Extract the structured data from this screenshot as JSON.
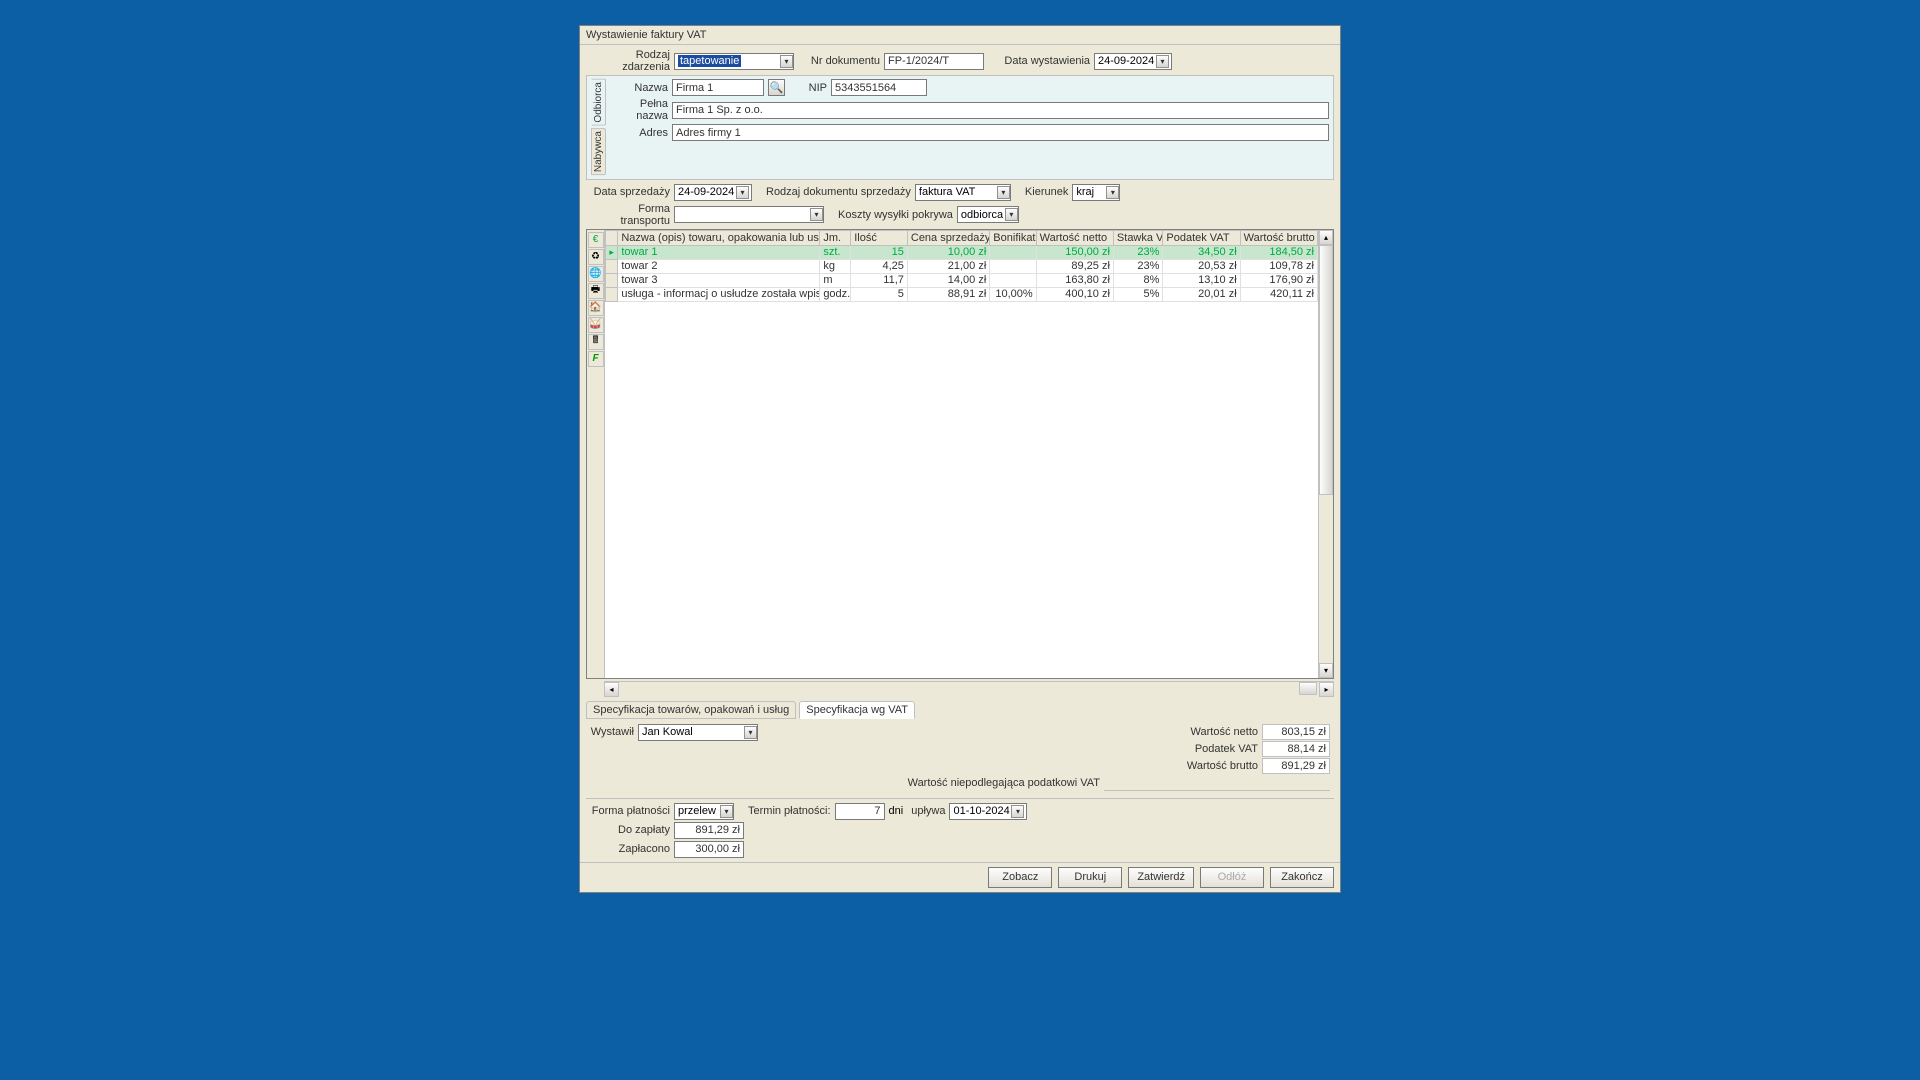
{
  "window": {
    "title": "Wystawienie faktury VAT"
  },
  "header": {
    "event_type_label": "Rodzaj zdarzenia",
    "event_type_value": "tapetowanie",
    "doc_no_label": "Nr dokumentu",
    "doc_no_value": "FP-1/2024/T",
    "issue_date_label": "Data wystawienia",
    "issue_date_value": "24-09-2024"
  },
  "contractor": {
    "tab1": "Odbiorca",
    "tab2": "Nabywca",
    "name_label": "Nazwa",
    "name_value": "Firma 1",
    "nip_label": "NIP",
    "nip_value": "5343551564",
    "fullname_label": "Pełna nazwa",
    "fullname_value": "Firma 1 Sp. z o.o.",
    "addr_label": "Adres",
    "addr_value": "Adres firmy 1"
  },
  "sale": {
    "sale_date_label": "Data sprzedaży",
    "sale_date_value": "24-09-2024",
    "doc_type_label": "Rodzaj dokumentu sprzedaży",
    "doc_type_value": "faktura VAT",
    "direction_label": "Kierunek",
    "direction_value": "kraj",
    "transport_label": "Forma transportu",
    "transport_value": "",
    "shipping_label": "Koszty wysyłki pokrywa",
    "shipping_value": "odbiorca"
  },
  "grid": {
    "cols": [
      "Nazwa (opis) towaru, opakowania lub usługi",
      "Jm.",
      "Ilość",
      "Cena sprzedaży netto",
      "Bonifikata",
      "Wartość netto",
      "Stawka VAT",
      "Podatek VAT",
      "Wartość brutto"
    ],
    "rows": [
      {
        "name": "towar 1",
        "jm": "szt.",
        "qty": "15",
        "price": "10,00 zł",
        "bon": "",
        "net": "150,00 zł",
        "rate": "23%",
        "vat": "34,50 zł",
        "gross": "184,50 zł"
      },
      {
        "name": "towar 2",
        "jm": "kg",
        "qty": "4,25",
        "price": "21,00 zł",
        "bon": "",
        "net": "89,25 zł",
        "rate": "23%",
        "vat": "20,53 zł",
        "gross": "109,78 zł"
      },
      {
        "name": "towar 3",
        "jm": "m",
        "qty": "11,7",
        "price": "14,00 zł",
        "bon": "",
        "net": "163,80 zł",
        "rate": "8%",
        "vat": "13,10 zł",
        "gross": "176,90 zł"
      },
      {
        "name": "usługa - informacj o usłudze została wpisana bezpośr",
        "jm": "godz.",
        "qty": "5",
        "price": "88,91 zł",
        "bon": "10,00%",
        "net": "400,10 zł",
        "rate": "5%",
        "vat": "20,01 zł",
        "gross": "420,11 zł"
      }
    ]
  },
  "tabs": {
    "spec_items": "Specyfikacja towarów, opakowań i usług",
    "spec_vat": "Specyfikacja wg VAT"
  },
  "bottom": {
    "issuer_label": "Wystawił",
    "issuer_value": "Jan Kowal",
    "net_label": "Wartość netto",
    "net_val": "803,15 zł",
    "vat_label": "Podatek VAT",
    "vat_val": "88,14 zł",
    "gross_label": "Wartość brutto",
    "gross_val": "891,29 zł",
    "nontax_label": "Wartość niepodlegająca podatkowi VAT"
  },
  "payment": {
    "form_label": "Forma płatności",
    "form_value": "przelew",
    "term_label": "Termin płatności:",
    "term_days": "7",
    "term_unit": "dni",
    "expires_label": "upływa",
    "expires_value": "01-10-2024",
    "to_pay_label": "Do zapłaty",
    "to_pay_value": "891,29 zł",
    "paid_label": "Zapłacono",
    "paid_value": "300,00 zł"
  },
  "buttons": {
    "view": "Zobacz",
    "print": "Drukuj",
    "confirm": "Zatwierdź",
    "postpone": "Odłóż",
    "close": "Zakończ"
  }
}
